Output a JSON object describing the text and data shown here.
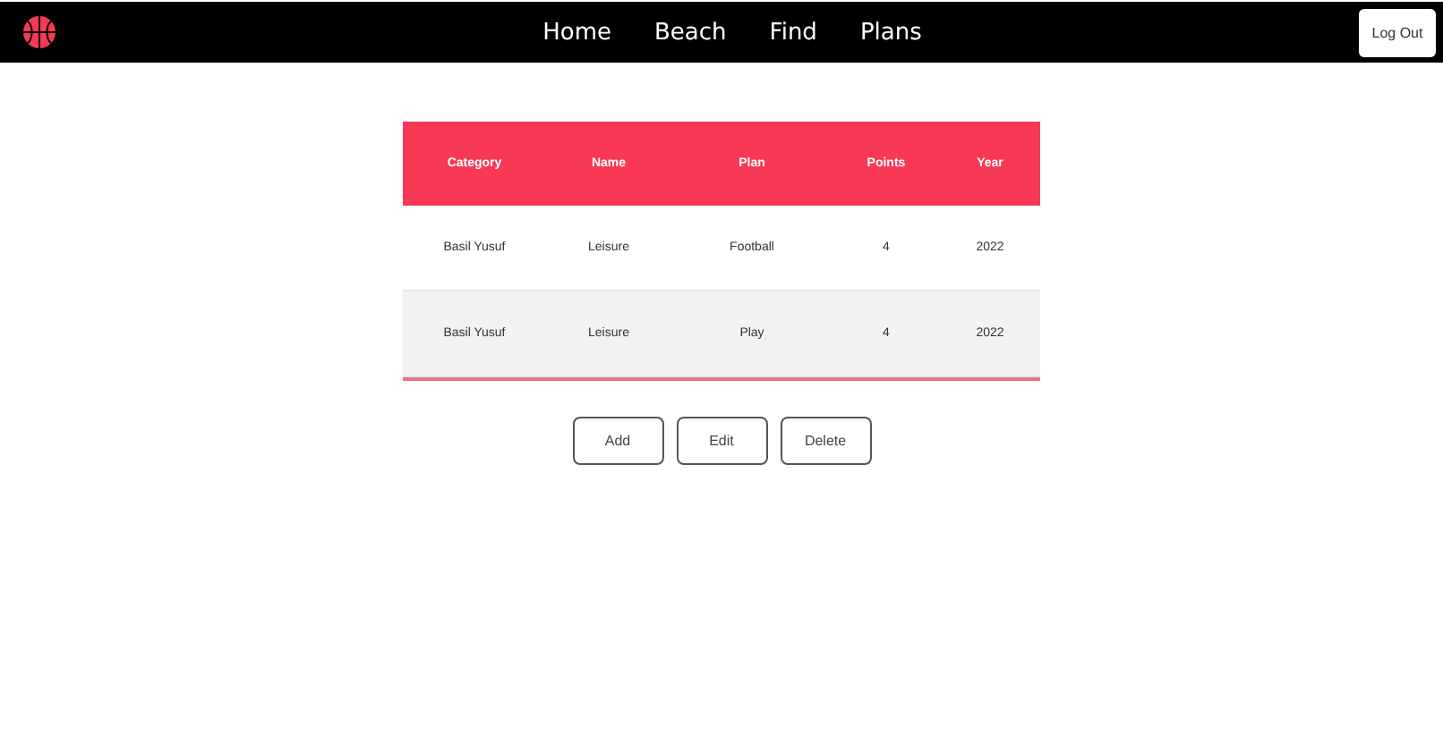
{
  "nav": {
    "links": [
      "Home",
      "Beach",
      "Find",
      "Plans"
    ],
    "logout": "Log Out"
  },
  "table": {
    "columns": [
      "Category",
      "Name",
      "Plan",
      "Points",
      "Year"
    ],
    "rows": [
      {
        "cells": [
          "Basil Yusuf",
          "Leisure",
          "Football",
          "4",
          "2022"
        ]
      },
      {
        "cells": [
          "Basil Yusuf",
          "Leisure",
          "Play",
          "4",
          "2022"
        ]
      }
    ]
  },
  "buttons": [
    "Add",
    "Edit",
    "Delete"
  ]
}
